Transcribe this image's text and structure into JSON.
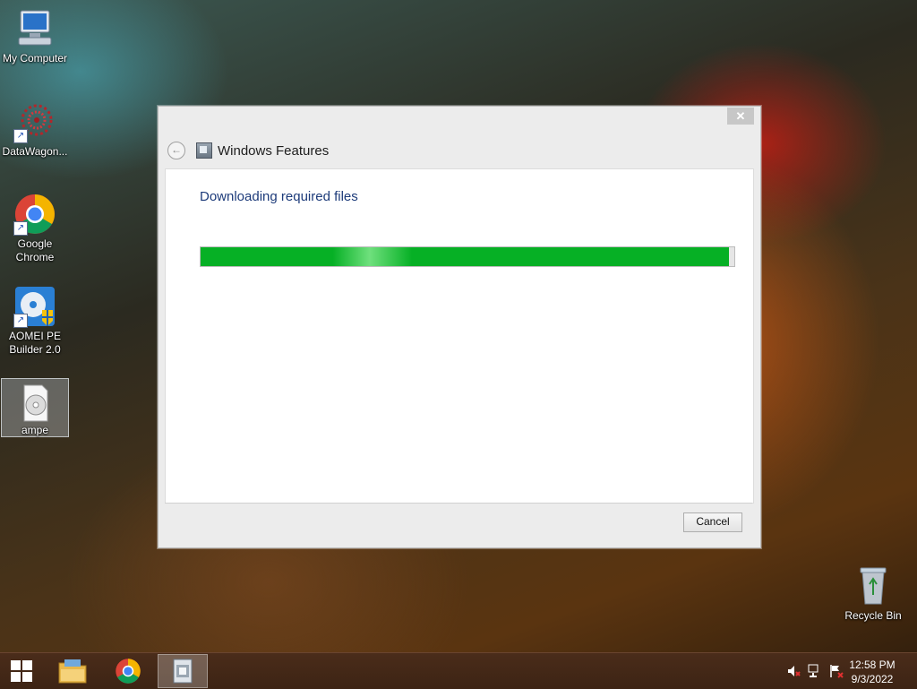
{
  "desktop": {
    "icons": [
      {
        "label": "My Computer",
        "icon": "computer-icon"
      },
      {
        "label": "DataWagon...",
        "icon": "datawagon-icon"
      },
      {
        "label": "Google Chrome",
        "icon": "chrome-icon"
      },
      {
        "label": "AOMEI PE Builder 2.0",
        "icon": "aomei-icon"
      },
      {
        "label": "ampe",
        "icon": "disc-image-icon"
      },
      {
        "label": "Recycle Bin",
        "icon": "recycle-bin-icon"
      }
    ]
  },
  "dialog": {
    "title": "Windows Features",
    "heading": "Downloading required files",
    "progress": 0.99,
    "cancel_label": "Cancel",
    "close_glyph": "✕"
  },
  "taskbar": {
    "items": [
      "start-icon",
      "file-explorer-icon",
      "chrome-icon",
      "windows-features-icon"
    ],
    "clock": {
      "time": "12:58 PM",
      "date": "9/3/2022"
    }
  },
  "colors": {
    "progress": "#06b025",
    "heading": "#1d3b7a"
  }
}
